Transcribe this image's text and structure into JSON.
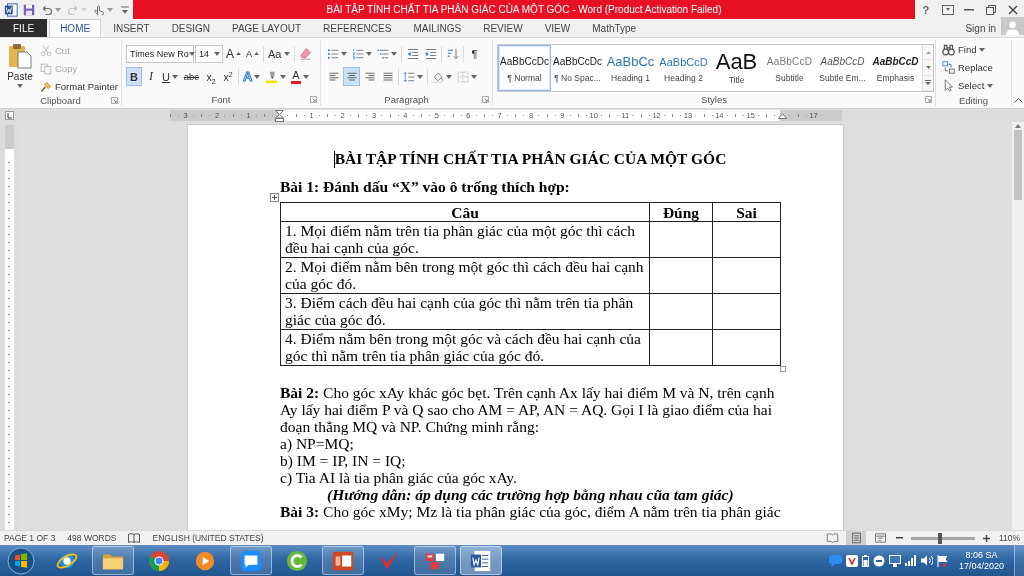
{
  "window": {
    "title": "BÀI TẬP TÍNH CHẤT TIA PHÂN GIÁC CỦA MỘT GÓC - Word (Product Activation Failed)",
    "help": "?"
  },
  "quick_access": [
    {
      "kind": "save",
      "disabled": false
    },
    {
      "kind": "undo",
      "disabled": false
    },
    {
      "kind": "redo",
      "disabled": true
    },
    {
      "kind": "touch",
      "disabled": false
    },
    {
      "kind": "customize",
      "disabled": false
    }
  ],
  "tabs": [
    {
      "label": "FILE",
      "kind": "file",
      "selected": false
    },
    {
      "label": "HOME",
      "kind": "tab",
      "selected": true
    },
    {
      "label": "INSERT",
      "kind": "tab",
      "selected": false
    },
    {
      "label": "DESIGN",
      "kind": "tab",
      "selected": false
    },
    {
      "label": "PAGE LAYOUT",
      "kind": "tab",
      "selected": false
    },
    {
      "label": "REFERENCES",
      "kind": "tab",
      "selected": false
    },
    {
      "label": "MAILINGS",
      "kind": "tab",
      "selected": false
    },
    {
      "label": "REVIEW",
      "kind": "tab",
      "selected": false
    },
    {
      "label": "VIEW",
      "kind": "tab",
      "selected": false
    },
    {
      "label": "MathType",
      "kind": "tab",
      "selected": false
    }
  ],
  "account": {
    "label": "Sign in"
  },
  "clipboard": {
    "label": "Clipboard",
    "paste": "Paste",
    "commands": [
      {
        "label": "Cut",
        "kind": "cut",
        "disabled": true
      },
      {
        "label": "Copy",
        "kind": "copy",
        "disabled": true
      },
      {
        "label": "Format Painter",
        "kind": "painter",
        "disabled": false
      }
    ]
  },
  "font": {
    "label": "Font",
    "family": "Times New Ro",
    "size": "14",
    "grow": "A",
    "shrink": "A",
    "change_case": "Aa",
    "styles": [
      {
        "label": "B",
        "kind": "bold",
        "selected": true
      },
      {
        "label": "I",
        "kind": "italic",
        "selected": false
      },
      {
        "label": "U",
        "kind": "underline",
        "selected": false
      },
      {
        "label": "abc",
        "kind": "strike",
        "selected": false
      },
      {
        "label": "x$_{2}$",
        "kind": "subscript",
        "selected": false
      },
      {
        "label": "x$^{2}$",
        "kind": "superscript",
        "selected": false
      }
    ],
    "effects": "A",
    "font_color": "A"
  },
  "paragraph": {
    "label": "Paragraph",
    "marks": "¶",
    "alignment": [
      {
        "kind": "left",
        "selected": false
      },
      {
        "kind": "center",
        "selected": true
      },
      {
        "kind": "right",
        "selected": false
      },
      {
        "kind": "justify",
        "selected": false
      }
    ]
  },
  "styles": {
    "label": "Styles",
    "items": [
      {
        "preview": "AaBbCcDc",
        "name": "¶ Normal",
        "kind": "normal",
        "selected": true
      },
      {
        "preview": "AaBbCcDc",
        "name": "¶ No Spac...",
        "kind": "nospacing",
        "selected": false
      },
      {
        "preview": "AaBbCc",
        "name": "Heading 1",
        "kind": "heading1",
        "selected": false
      },
      {
        "preview": "AaBbCcD",
        "name": "Heading 2",
        "kind": "heading2",
        "selected": false
      },
      {
        "preview": "AaB",
        "name": "Title",
        "kind": "title",
        "selected": false
      },
      {
        "preview": "AaBbCcD",
        "name": "Subtitle",
        "kind": "subtitle",
        "selected": false
      },
      {
        "preview": "AaBbCcD",
        "name": "Subtle Em...",
        "kind": "subtle",
        "selected": false
      },
      {
        "preview": "AaBbCcD",
        "name": "Emphasis",
        "kind": "emphasis",
        "selected": false
      }
    ]
  },
  "editing": {
    "label": "Editing",
    "commands": [
      {
        "label": "Find",
        "kind": "find"
      },
      {
        "label": "Replace",
        "kind": "replace"
      },
      {
        "label": "Select",
        "kind": "select"
      }
    ]
  },
  "ruler": {
    "left_numbers": [
      "3",
      "2",
      "1"
    ],
    "numbers": [
      "1",
      "2",
      "3",
      "4",
      "5",
      "6",
      "7",
      "8",
      "9",
      "10",
      "11",
      "12",
      "13",
      "14",
      "15"
    ],
    "right_numbers": [
      "17"
    ]
  },
  "document": {
    "title": "BÀI TẬP TÍNH CHẤT TIA PHÂN GIÁC CỦA MỘT GÓC",
    "exercise_1": "Bài 1: Đánh dấu “X” vào ô trống thích hợp:",
    "table": {
      "columns": [
        "Câu",
        "Đúng",
        "Sai"
      ],
      "rows": [
        {
          "statement": "1. Mọi điểm nằm trên tia phân giác của một góc thì cách đều hai cạnh của góc."
        },
        {
          "statement": "2. Mọi điểm nằm bên trong một góc thì cách đều hai cạnh của góc đó."
        },
        {
          "statement": "3. Điểm cách đều hai cạnh của góc thì nằm trên tia phân giác của góc đó."
        },
        {
          "statement": "4. Điểm nằm bên trong một góc và cách đều hai cạnh của góc thì nằm trên tia phân giác của góc đó."
        }
      ]
    },
    "exercise_2": {
      "text": "**Bài 2:** Cho góc xAy khác góc bẹt. Trên cạnh Ax lấy hai điểm M và N, trên cạnh Ay lấy hai điểm P và Q sao cho AM = AP, AN = AQ. Gọi I là giao điểm của hai đoạn thẳng MQ và NP. Chứng minh rằng:",
      "parts": [
        "a) NP=MQ;",
        "b) IM = IP, IN = IQ;",
        "c) Tia AI là tia phân giác của góc xAy."
      ],
      "hint": "(Hướng dẫn: áp dụng các trường hợp bằng nhau cũa tam giác)"
    },
    "exercise_3": "**Bài 3:** Cho góc xMy; Mz là tia phân giác của góc, điểm A nằm trên tia phân giác"
  },
  "status_bar": {
    "page": "PAGE 1 OF 3",
    "words": "498 WORDS",
    "language": "ENGLISH (UNITED STATES)",
    "views": [
      {
        "kind": "read",
        "selected": false
      },
      {
        "kind": "print",
        "selected": true
      },
      {
        "kind": "web",
        "selected": false
      }
    ],
    "zoom": {
      "level": 0.45,
      "reading": "110%"
    }
  },
  "taskbar": {
    "apps": [
      {
        "kind": "orbit",
        "running": false,
        "selected": false
      },
      {
        "kind": "folder",
        "running": true,
        "selected": false
      },
      {
        "kind": "wheel",
        "running": false,
        "selected": false
      },
      {
        "kind": "play",
        "running": false,
        "selected": false
      },
      {
        "kind": "chat",
        "running": true,
        "selected": false
      },
      {
        "kind": "swirl",
        "running": false,
        "selected": false
      },
      {
        "kind": "slides",
        "running": true,
        "selected": false
      },
      {
        "kind": "tick",
        "running": false,
        "selected": false
      },
      {
        "kind": "tiles",
        "running": true,
        "selected": false
      },
      {
        "kind": "document",
        "running": true,
        "selected": true
      }
    ],
    "time": "8:06 SA",
    "date": "17/04/2020"
  }
}
